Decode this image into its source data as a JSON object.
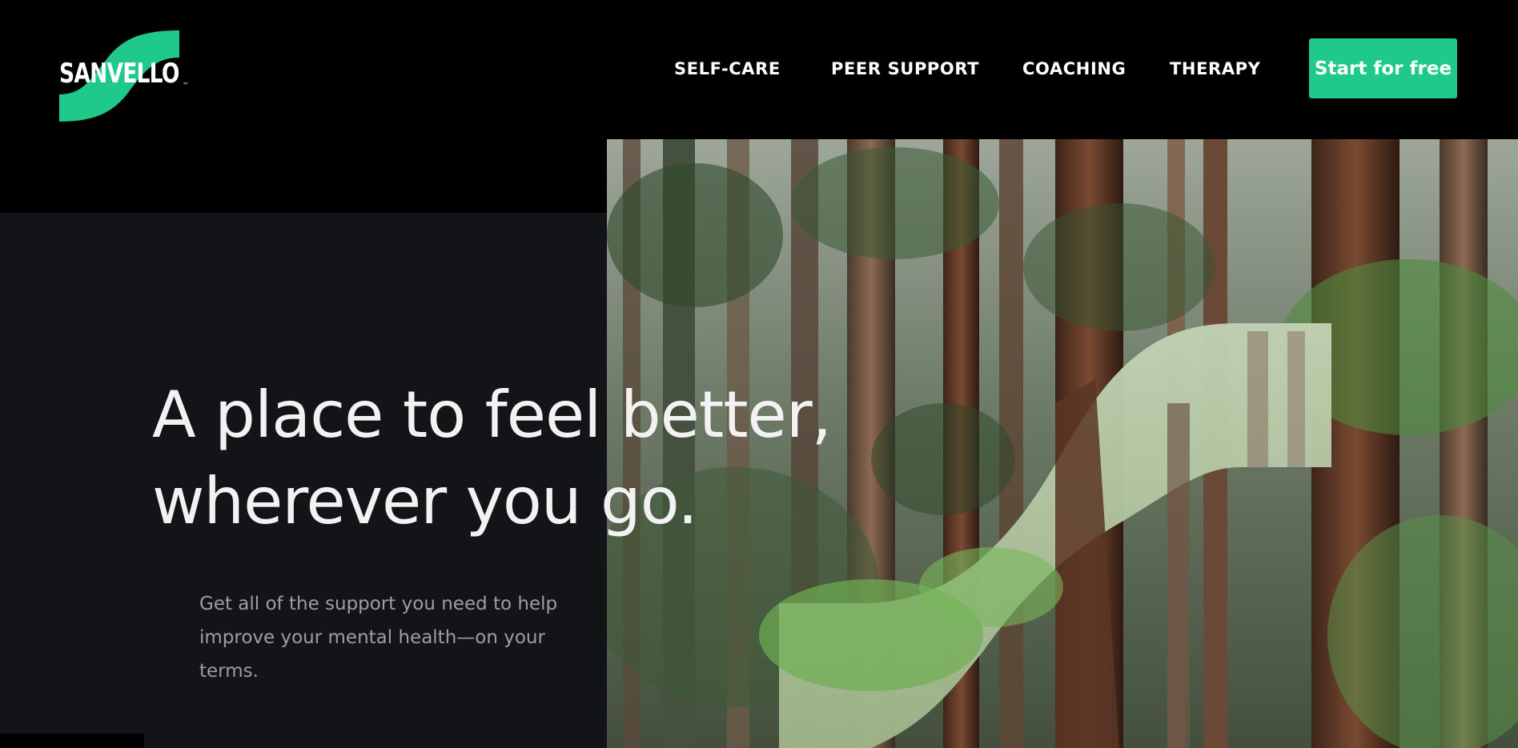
{
  "header": {
    "logo_text": "SANVELLO",
    "logo_tm": "™",
    "nav": [
      {
        "label": "SELF-CARE"
      },
      {
        "label": "PEER SUPPORT"
      },
      {
        "label": "COACHING"
      },
      {
        "label": "THERAPY"
      }
    ],
    "cta_label": "Start for free"
  },
  "hero": {
    "headline_line1": "A place to feel better,",
    "headline_line2": "wherever you go.",
    "subtext": "Get all of the support you need to help improve your mental health—on your terms."
  },
  "colors": {
    "accent": "#1ec989",
    "background": "#000000",
    "panel": "#131418",
    "text": "#f2f2f2",
    "muted_text": "#9c9ea4"
  },
  "icons": {
    "logo": "sanvello-s-swoosh-icon",
    "hero_image": "redwood-forest-photo"
  }
}
